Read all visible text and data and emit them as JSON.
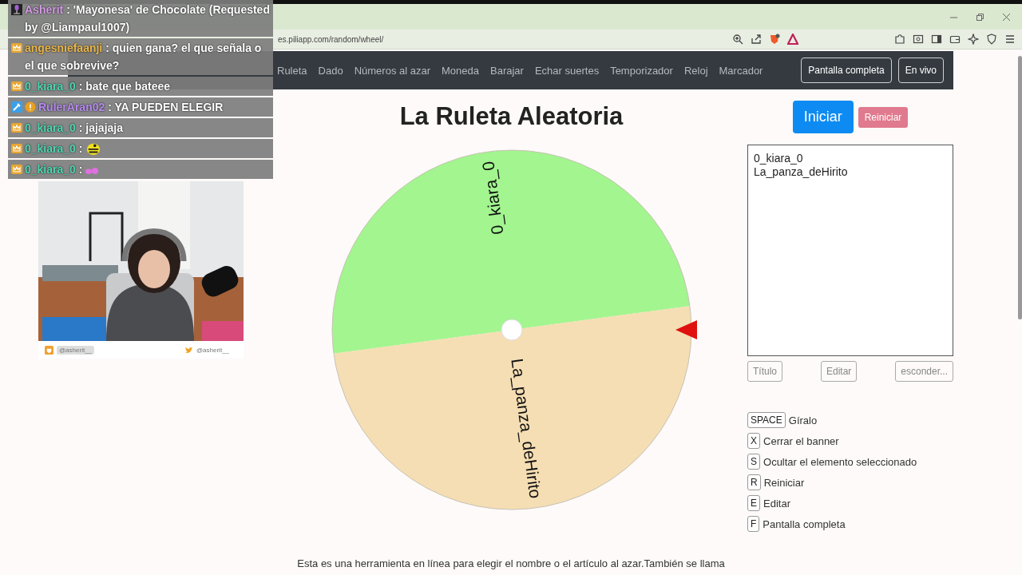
{
  "browser": {
    "url": "es.piliapp.com/random/wheel/"
  },
  "nav": {
    "links": [
      "Ruleta",
      "Dado",
      "Números al azar",
      "Moneda",
      "Barajar",
      "Echar suertes",
      "Temporizador",
      "Reloj",
      "Marcador"
    ],
    "buttons": [
      "Pantalla completa",
      "En vivo"
    ]
  },
  "page": {
    "title": "La Ruleta Aleatoria",
    "footer": "Esta es una herramienta en línea para elegir el nombre o el artículo al azar.También se llama"
  },
  "wheel": {
    "segments": [
      {
        "label": "0_kiara_0",
        "color": "#a2f58f"
      },
      {
        "label": "La_panza_deHirito",
        "color": "#f5deb3"
      }
    ]
  },
  "controls": {
    "start": "Iniciar",
    "reset": "Reiniciar"
  },
  "entries": {
    "value": "0_kiara_0\nLa_panza_deHirito"
  },
  "entry_buttons": [
    "Título",
    "Editar",
    "esconder..."
  ],
  "shortcuts": [
    {
      "key": "SPACE",
      "label": "Gíralo"
    },
    {
      "key": "X",
      "label": "Cerrar el banner"
    },
    {
      "key": "S",
      "label": "Ocultar el elemento seleccionado"
    },
    {
      "key": "R",
      "label": "Reiniciar"
    },
    {
      "key": "E",
      "label": "Editar"
    },
    {
      "key": "F",
      "label": "Pantalla completa"
    }
  ],
  "chat": {
    "messages": [
      {
        "user": "Asherit",
        "color": "#d59be6",
        "badges": [
          {
            "kind": "mic"
          }
        ],
        "text": ": 'Mayonesa' de Chocolate (Requested by @Liampaul1007)"
      },
      {
        "user": "angesniefaanji",
        "color": "#e8b64a",
        "badges": [
          {
            "kind": "crown"
          }
        ],
        "text": ": quien gana? el que señala o el que sobrevive?"
      },
      {
        "user": "0_kiara_0",
        "color": "#4fd6b0",
        "badges": [
          {
            "kind": "crown"
          }
        ],
        "text": ": bate que bateee"
      },
      {
        "user": "RulerAran02",
        "color": "#b58af0",
        "badges": [
          {
            "kind": "wrench"
          },
          {
            "kind": "alert"
          }
        ],
        "text": ": YA PUEDEN ELEGIR"
      },
      {
        "user": "0_kiara_0",
        "color": "#4fd6b0",
        "badges": [
          {
            "kind": "crown"
          }
        ],
        "text": ": jajajaja"
      },
      {
        "user": "0_kiara_0",
        "color": "#4fd6b0",
        "badges": [
          {
            "kind": "crown"
          }
        ],
        "text": ":",
        "emote": {
          "kind": "bee"
        }
      },
      {
        "user": "0_kiara_0",
        "color": "#4fd6b0",
        "badges": [
          {
            "kind": "crown"
          }
        ],
        "text": ":",
        "emote": {
          "kind": "blob"
        }
      }
    ]
  },
  "webcam": {
    "kind": "picture",
    "handles": [
      {
        "kind": "streamer",
        "label": "@asherit__"
      },
      {
        "kind": "twitter",
        "label": "@asherit__"
      }
    ]
  }
}
